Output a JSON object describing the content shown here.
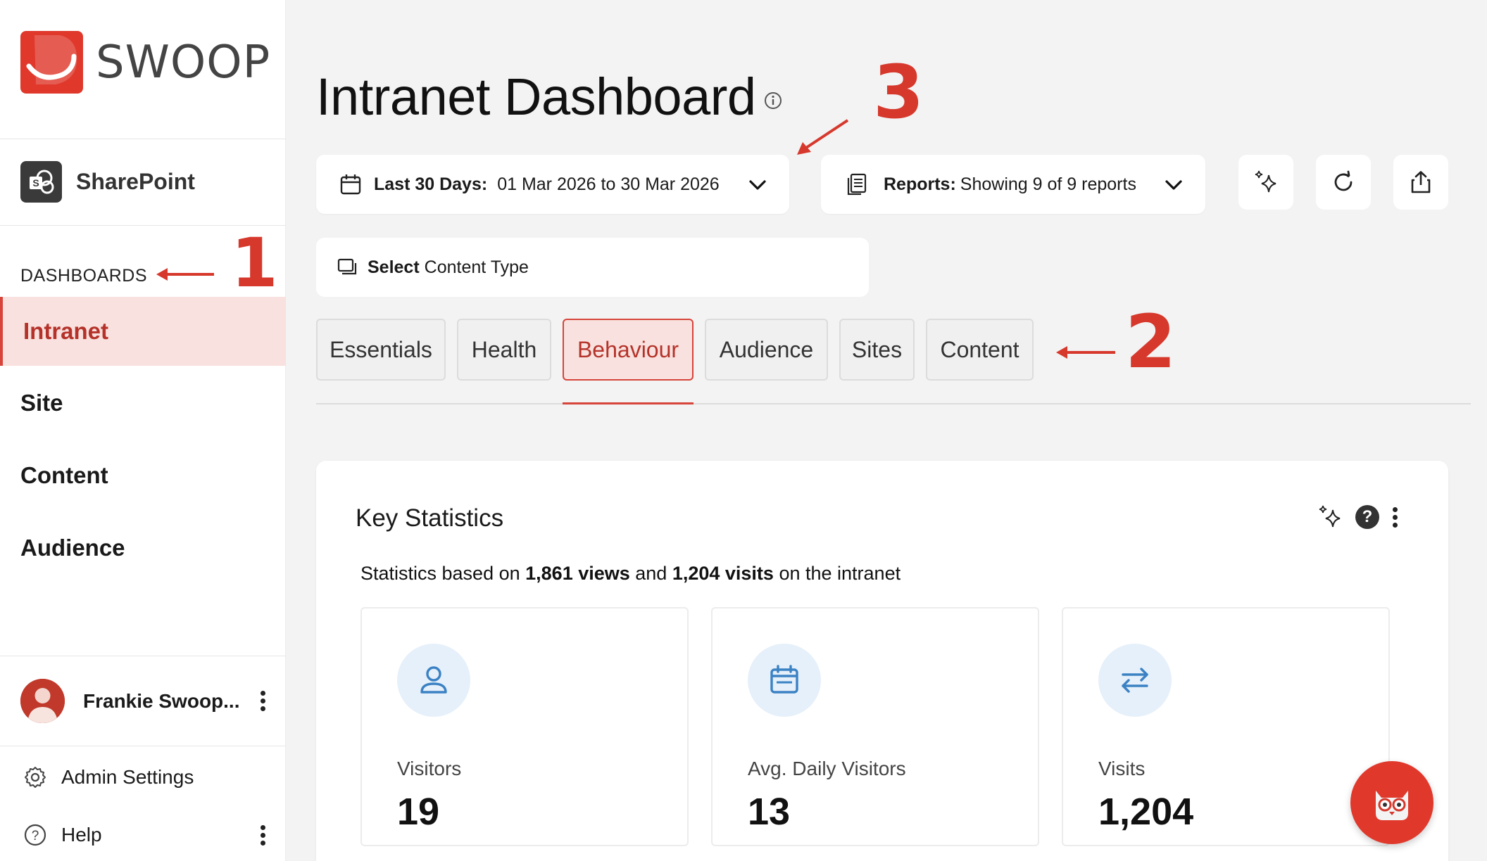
{
  "brand": {
    "name": "SWOOP",
    "color": "#e0392c"
  },
  "sidebar": {
    "platform": "SharePoint",
    "section_heading": "DASHBOARDS",
    "items": [
      {
        "label": "Intranet",
        "active": true
      },
      {
        "label": "Site",
        "active": false
      },
      {
        "label": "Content",
        "active": false
      },
      {
        "label": "Audience",
        "active": false
      }
    ],
    "user": {
      "name": "Frankie Swoop..."
    },
    "admin_settings": "Admin Settings",
    "help": "Help"
  },
  "header": {
    "title": "Intranet Dashboard",
    "date_range": {
      "label": "Last 30 Days:",
      "value": "01 Mar 2026 to 30 Mar 2026"
    },
    "reports": {
      "label": "Reports:",
      "value": "Showing 9 of 9 reports"
    },
    "content_type": {
      "label": "Select",
      "value": "Content Type"
    }
  },
  "tabs": [
    {
      "label": "Essentials",
      "active": false
    },
    {
      "label": "Health",
      "active": false
    },
    {
      "label": "Behaviour",
      "active": true
    },
    {
      "label": "Audience",
      "active": false
    },
    {
      "label": "Sites",
      "active": false
    },
    {
      "label": "Content",
      "active": false
    }
  ],
  "key_statistics": {
    "title": "Key Statistics",
    "summary": {
      "prefix": "Statistics based on ",
      "views": "1,861 views",
      "mid": " and ",
      "visits": "1,204 visits",
      "suffix": " on the intranet"
    },
    "stats": [
      {
        "label": "Visitors",
        "value": "19",
        "icon": "user-icon"
      },
      {
        "label": "Avg. Daily Visitors",
        "value": "13",
        "icon": "calendar-icon"
      },
      {
        "label": "Visits",
        "value": "1,204",
        "icon": "swap-arrows-icon"
      }
    ]
  },
  "annotations": {
    "one": "1",
    "two": "2",
    "three": "3"
  },
  "colors": {
    "accent": "#d6443a",
    "active_bg": "#f8e1de",
    "stat_icon_bg": "#e6f0fa",
    "stat_icon": "#3b82c4"
  }
}
